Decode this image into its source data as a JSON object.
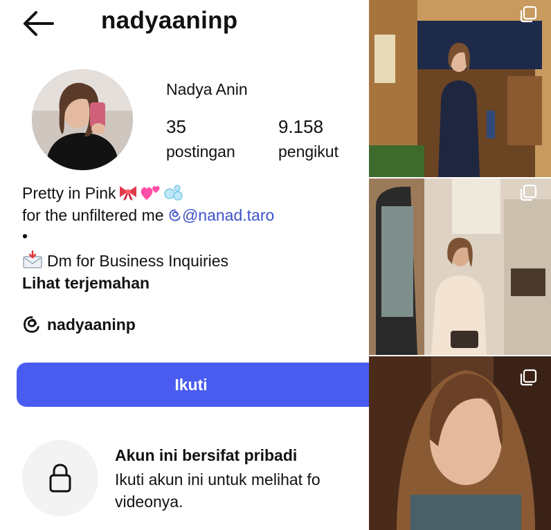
{
  "header": {
    "username": "nadyaaninp"
  },
  "profile": {
    "display_name": "Nadya Anin",
    "stats": [
      {
        "value": "35",
        "label": "postingan"
      },
      {
        "value": "9.158",
        "label": "pengikut"
      }
    ],
    "bio": {
      "line1": "Pretty in Pink",
      "line2_prefix": "for the unfiltered me ",
      "line2_mention": "@nanad.taro",
      "line3": "•",
      "line4": "Dm for Business Inquiries"
    },
    "translate_link": "Lihat terjemahan",
    "threads_handle": "nadyaaninp"
  },
  "actions": {
    "follow_label": "Ikuti"
  },
  "private_notice": {
    "title": "Akun ini bersifat pribadi",
    "description_line1": "Ikuti akun ini untuk melihat fo",
    "description_line2": "videonya."
  },
  "icons": {
    "back": "arrow-left-icon",
    "threads": "threads-icon",
    "lock": "lock-icon",
    "multi_post": "multiple-posts-icon",
    "bio_emojis": [
      "ribbon",
      "two-hearts",
      "bubbles"
    ],
    "envelope": "envelope-with-arrow"
  },
  "colors": {
    "follow_button": "#4a5cf0",
    "mention": "#3d52c9",
    "lock_bg": "#f3f3f3"
  }
}
